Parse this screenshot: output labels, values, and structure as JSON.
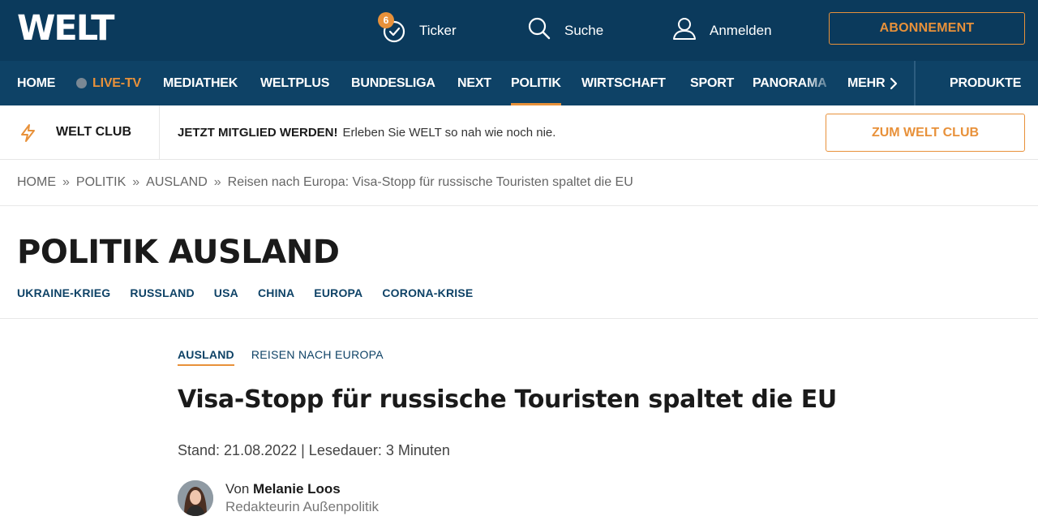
{
  "header": {
    "logo": "WELT",
    "ticker_badge": "6",
    "ticker_label": "Ticker",
    "search_label": "Suche",
    "login_label": "Anmelden",
    "subscribe_label": "ABONNEMENT"
  },
  "nav": {
    "items": [
      "HOME",
      "LIVE-TV",
      "MEDIATHEK",
      "WELTPLUS",
      "BUNDESLIGA",
      "NEXT",
      "POLITIK",
      "WIRTSCHAFT",
      "SPORT",
      "PANORAMA",
      "MEHR"
    ],
    "active": "POLITIK",
    "products_label": "PRODUKTE"
  },
  "club": {
    "label": "WELT CLUB",
    "cta_bold": "JETZT MITGLIED WERDEN!",
    "cta_text": "Erleben Sie WELT so nah wie noch nie.",
    "button_label": "ZUM WELT CLUB"
  },
  "breadcrumb": [
    "HOME",
    "POLITIK",
    "AUSLAND",
    "Reisen nach Europa: Visa-Stopp für russische Touristen spaltet die EU"
  ],
  "breadcrumb_separator": "»",
  "section": {
    "title": "POLITIK AUSLAND",
    "subnav": [
      "UKRAINE-KRIEG",
      "RUSSLAND",
      "USA",
      "CHINA",
      "EUROPA",
      "CORONA-KRISE"
    ]
  },
  "article": {
    "topic": "AUSLAND",
    "subtopic": "REISEN NACH EUROPA",
    "headline": "Visa-Stopp für russische Touristen spaltet die EU",
    "meta": "Stand: 21.08.2022 | Lesedauer: 3 Minuten",
    "author_prefix": "Von",
    "author_name": "Melanie Loos",
    "author_role": "Redakteurin Außenpolitik"
  },
  "colors": {
    "header_bg": "#0b3a5c",
    "nav_bg": "#0e4266",
    "accent": "#e8913a"
  }
}
